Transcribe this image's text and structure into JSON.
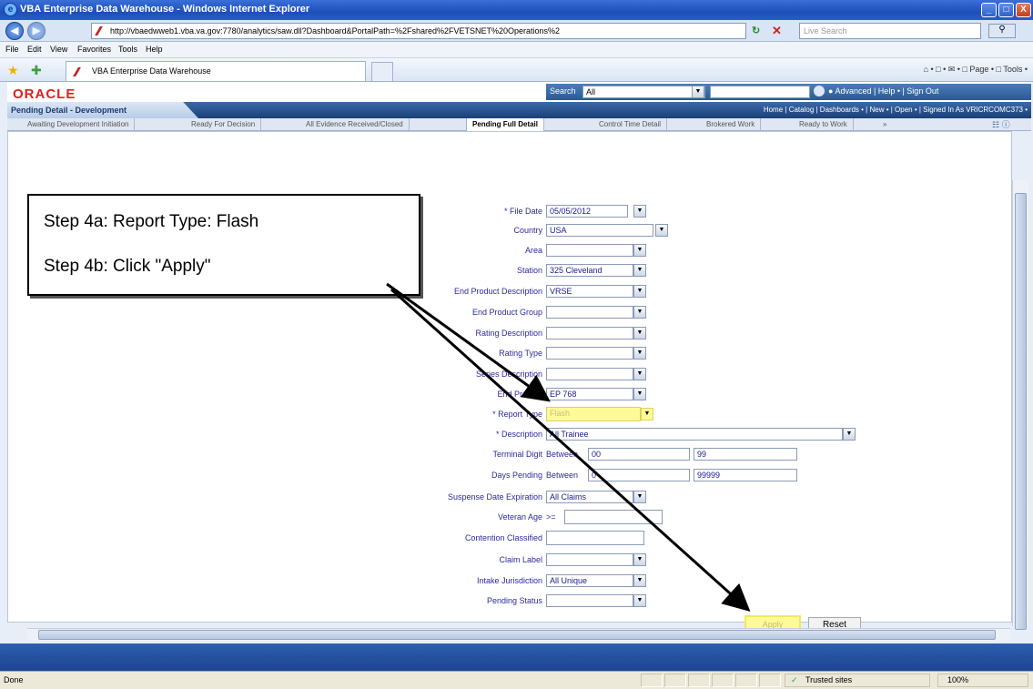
{
  "window": {
    "title": "VBA Enterprise Data Warehouse - Windows Internet Explorer",
    "min": "_",
    "max": "□",
    "close": "X"
  },
  "address": {
    "url": "http://vbaedwweb1.vba.va.gov:7780/analytics/saw.dll?Dashboard&PortalPath=%2Fshared%2FVETSNET%20Operations%2",
    "search_placeholder": "Live Search",
    "back": "◀",
    "forward": "▶"
  },
  "menu": [
    "File",
    "Edit",
    "View",
    "Favorites",
    "Tools",
    "Help"
  ],
  "ie_tab": "VBA Enterprise Data Warehouse",
  "command_bar": "⌂ • □ • ✉ • □ Page • □ Tools •",
  "oracle": {
    "logo": "ORACLE",
    "search_label": "Search",
    "search_scope": "All",
    "links": "● Advanced  |  Help •  |  Sign Out"
  },
  "dashboard": {
    "title": "Pending Detail - Development",
    "links": "Home | Catalog | Dashboards • | New • | Open • | Signed In As VRICRCOMC373 •"
  },
  "page_tabs": [
    "Awaiting Development Initiation",
    "Ready For Decision",
    "All Evidence Received/Closed",
    "Pending Full Detail",
    "Control Time Detail",
    "Brokered Work",
    "Ready to Work",
    "»"
  ],
  "callout": {
    "line1": "Step 4a: Report Type: Flash",
    "line2": "Step 4b: Click \"Apply\""
  },
  "prompts": {
    "file_date": {
      "label": "* File Date",
      "value": "05/05/2012"
    },
    "country": {
      "label": "Country",
      "value": "USA"
    },
    "area": {
      "label": "Area",
      "value": ""
    },
    "station": {
      "label": "Station",
      "value": "325 Cleveland"
    },
    "ep_desc": {
      "label": "End Product Description",
      "value": "VRSE"
    },
    "ep_group": {
      "label": "End Product Group",
      "value": ""
    },
    "rating_desc": {
      "label": "Rating Description",
      "value": ""
    },
    "rating_type": {
      "label": "Rating Type",
      "value": ""
    },
    "series_desc": {
      "label": "Series Description",
      "value": ""
    },
    "end_product": {
      "label": "End Product",
      "value": "EP 768"
    },
    "report_type": {
      "label": "* Report Type",
      "value": "Flash"
    },
    "description": {
      "label": "* Description",
      "value": "All Trainee"
    },
    "terminal_digit": {
      "label": "Terminal Digit",
      "op": "Between",
      "v1": "00",
      "v2": "99"
    },
    "days_pending": {
      "label": "Days Pending",
      "op": "Between",
      "v1": "0",
      "v2": "99999"
    },
    "suspense": {
      "label": "Suspense Date Expiration",
      "value": "All Claims"
    },
    "veteran_age": {
      "label": "Veteran Age",
      "op": ">=",
      "value": ""
    },
    "contention": {
      "label": "Contention Classified",
      "value": ""
    },
    "claim_label": {
      "label": "Claim Label",
      "value": ""
    },
    "intake": {
      "label": "Intake Jurisdiction",
      "value": "All Unique"
    },
    "pending_status": {
      "label": "Pending Status",
      "value": ""
    }
  },
  "buttons": {
    "apply": "Apply",
    "reset": "Reset"
  },
  "status": {
    "done": "Done",
    "trusted": "Trusted sites",
    "zoom": "100%"
  },
  "dd_glyph": "▼"
}
